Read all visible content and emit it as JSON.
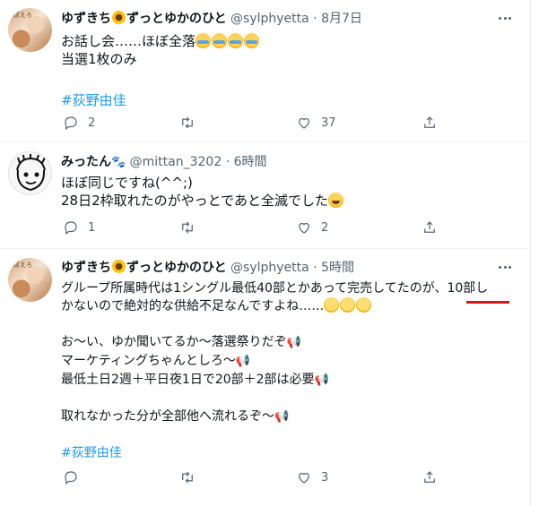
{
  "colors": {
    "link": "#1d9bf0",
    "muted": "#536471",
    "annotation": "#e0101c"
  },
  "tweets": [
    {
      "name": "ゆずきち",
      "name_suffix": "ずっとゆかのひと",
      "handle": "@sylphyetta",
      "time": "8月7日",
      "avatar_text": "ぽえろ",
      "lines": [
        "お話し会……ほぼ全落",
        "当選1枚のみ",
        "",
        "#荻野由佳"
      ],
      "replies": "2",
      "retweets": "",
      "likes": "37"
    },
    {
      "name": "みったん",
      "handle": "@mittan_3202",
      "time": "6時間",
      "lines": [
        "ほぼ同じですね(^^;)",
        "28日2枠取れたのがやっとであと全滅でした"
      ],
      "replies": "1",
      "retweets": "",
      "likes": "2"
    },
    {
      "name": "ゆずきち",
      "name_suffix": "ずっとゆかのひと",
      "handle": "@sylphyetta",
      "time": "5時間",
      "lines": [
        "グループ所属時代は1シングル最低40部とかあって完売してたのが、10部し",
        "かないので絶対的な供給不足なんですよね……",
        "",
        "お～い、ゆか聞いてるか～落選祭りだぞ",
        "マーケティングちゃんとしろ～",
        "最低土日2週＋平日夜1日で20部＋2部は必要",
        "",
        "取れなかった分が全部他へ流れるぞ～",
        "",
        "#荻野由佳"
      ],
      "replies": "",
      "retweets": "",
      "likes": "3"
    }
  ],
  "icons": [
    "reply-icon",
    "retweet-icon",
    "like-icon",
    "share-icon",
    "more-icon"
  ]
}
